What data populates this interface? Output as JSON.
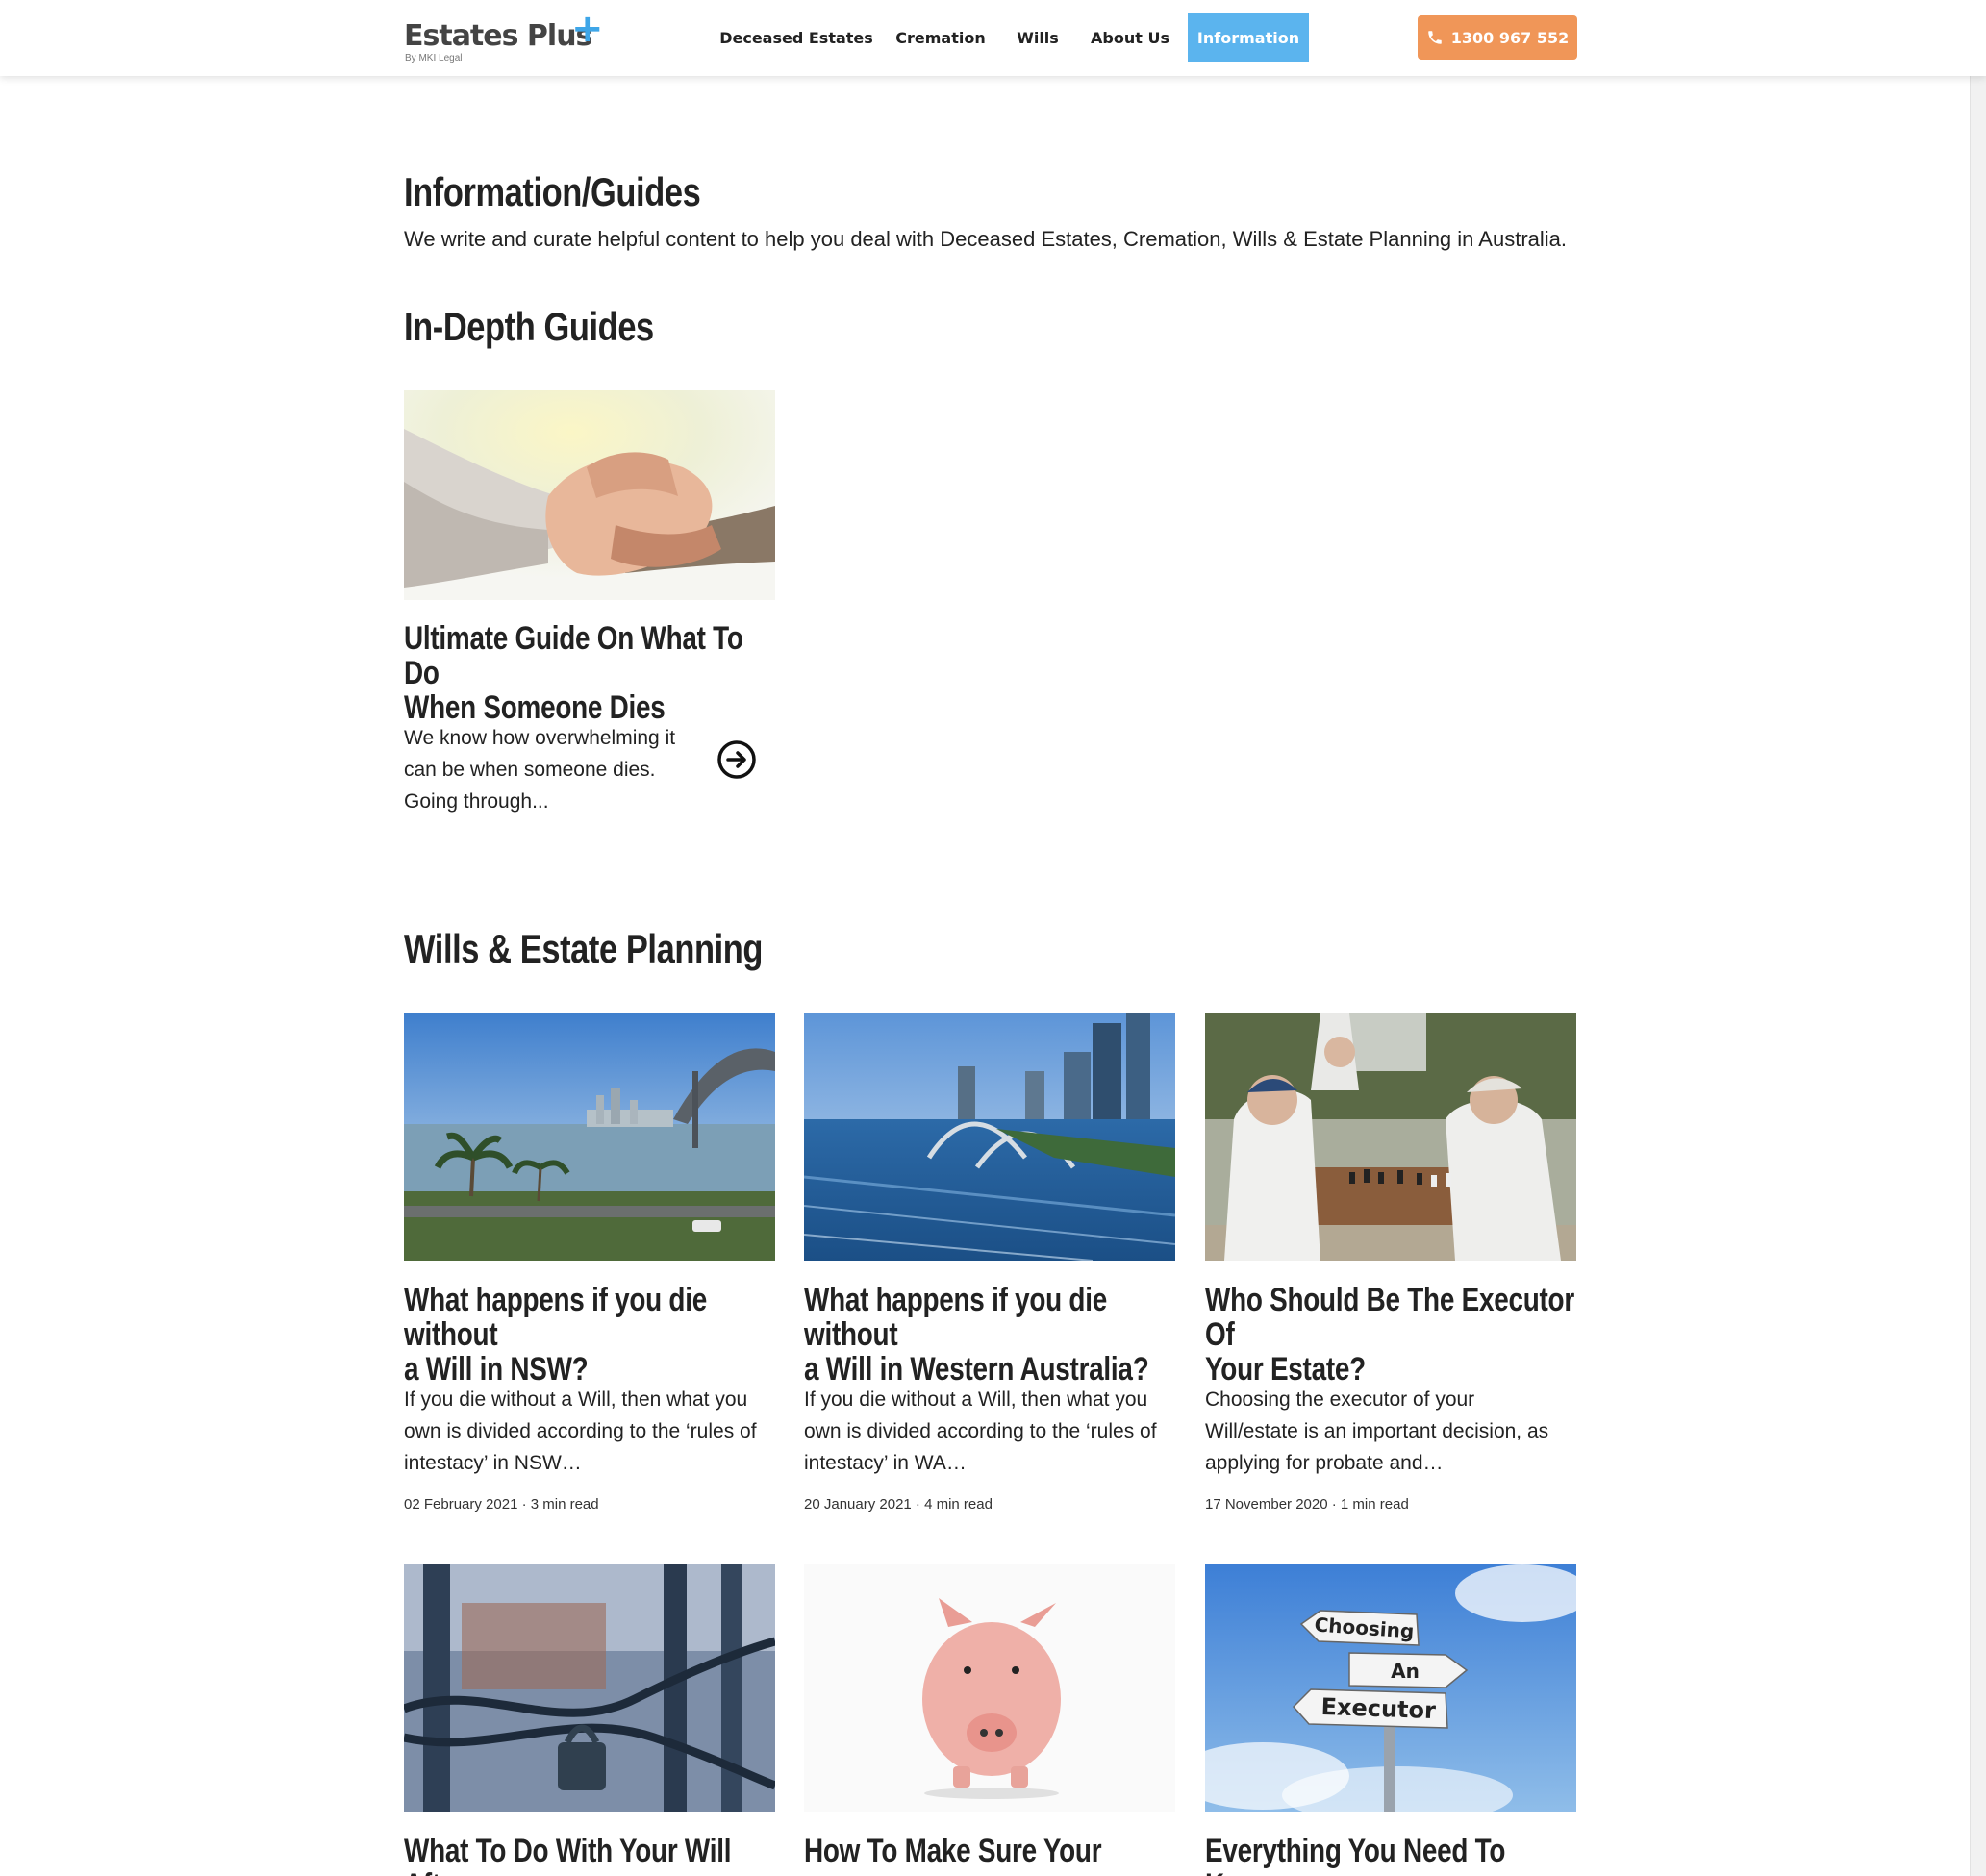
{
  "header": {
    "logo_text": "Estates Plus",
    "logo_plus": "+",
    "logo_sub": "By MKI Legal",
    "nav": [
      "Deceased Estates",
      "Cremation",
      "Wills",
      "About Us",
      "Information"
    ],
    "phone": "1300 967 552",
    "phone_icon": "phone-icon"
  },
  "page": {
    "title": "Information/Guides",
    "lead": "We write and curate helpful content to help you deal with Deceased Estates, Cremation, Wills & Estate Planning in Australia."
  },
  "guides": {
    "heading": "In-Depth Guides",
    "items": [
      {
        "title_line1": "Ultimate Guide On What To Do",
        "title_line2": "When Someone Dies",
        "excerpt_line1": "We know how overwhelming it",
        "excerpt_line2": "can be when someone dies.",
        "excerpt_line3": "Going through...",
        "arrow_icon": "arrow-right-circle-icon"
      }
    ]
  },
  "wills": {
    "heading": "Wills & Estate Planning",
    "posts": [
      {
        "title_line1": "What happens if you die without",
        "title_line2": "a Will in NSW?",
        "excerpt_line1": "If you die without a Will, then what you",
        "excerpt_line2": "own is divided according to the ‘rules of",
        "excerpt_line3": "intestacy’ in NSW…",
        "meta": "02 February 2021 · 3 min read"
      },
      {
        "title_line1": "What happens if you die without",
        "title_line2": "a Will in Western Australia?",
        "excerpt_line1": "If you die without a Will, then what you",
        "excerpt_line2": "own is divided according to the ‘rules of",
        "excerpt_line3": "intestacy’ in WA…",
        "meta": "20 January 2021 · 4 min read"
      },
      {
        "title_line1": "Who Should Be The Executor Of",
        "title_line2": "Your Estate?",
        "excerpt_line1": "Choosing the executor of your",
        "excerpt_line2": "Will/estate is an important decision, as",
        "excerpt_line3": "applying for probate and…",
        "meta": "17 November 2020 · 1 min read"
      },
      {
        "title_line1": "What To Do With Your Will After"
      },
      {
        "title_line1": "How To Make Sure Your"
      },
      {
        "title_line1": "Everything You Need To Know",
        "sign_words": [
          "Choosing",
          "An",
          "Executor"
        ]
      }
    ]
  }
}
